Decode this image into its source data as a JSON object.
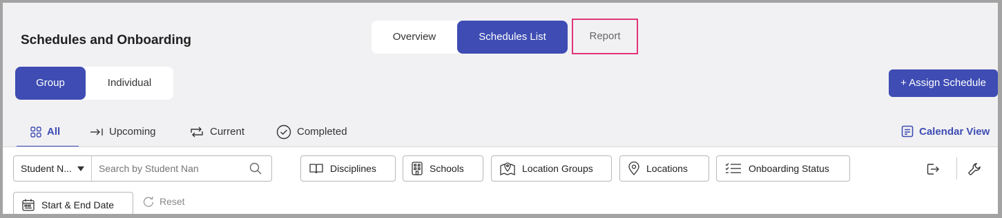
{
  "header": {
    "title": "Schedules and Onboarding"
  },
  "top_tabs": [
    {
      "label": "Overview",
      "active": false
    },
    {
      "label": "Schedules List",
      "active": true
    },
    {
      "label": "Report",
      "active": false
    }
  ],
  "mode_toggle": [
    {
      "label": "Group",
      "active": true
    },
    {
      "label": "Individual",
      "active": false
    }
  ],
  "assign_button": {
    "label": "+ Assign Schedule"
  },
  "status_tabs": [
    {
      "label": "All",
      "icon": "grid-icon",
      "active": true
    },
    {
      "label": "Upcoming",
      "icon": "arrow-right-bar-icon",
      "active": false
    },
    {
      "label": "Current",
      "icon": "cycle-icon",
      "active": false
    },
    {
      "label": "Completed",
      "icon": "check-circle-icon",
      "active": false
    }
  ],
  "calendar_view": {
    "label": "Calendar View",
    "icon": "calendar-doc-icon"
  },
  "filters": {
    "search_by": "Student N...",
    "search_placeholder": "Search by Student Nan",
    "disciplines": "Disciplines",
    "schools": "Schools",
    "location_groups": "Location Groups",
    "locations": "Locations",
    "onboarding_status": "Onboarding Status",
    "date_range": "Start & End Date",
    "reset": "Reset"
  },
  "colors": {
    "primary": "#3e4cb3",
    "highlight": "#e0347a"
  }
}
